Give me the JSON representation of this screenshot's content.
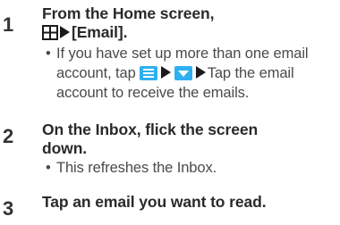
{
  "steps": [
    {
      "number": "1",
      "text_line1": "From the Home screen,",
      "text_line2": "[Email].",
      "apps_icon": "apps-grid-icon",
      "bullet": {
        "line1": "If you have set up more than one email",
        "line2_prefix": "account, tap",
        "line3": "account to receive the emails.",
        "tap_the_email": "Tap the email",
        "menu_icon": "menu-icon",
        "dropdown_icon": "dropdown-icon"
      }
    },
    {
      "number": "2",
      "text_line1": "On the Inbox, flick the screen",
      "text_line2": "down.",
      "bullet": {
        "line1": "This refreshes the Inbox."
      }
    },
    {
      "number": "3",
      "text_line1": "Tap an email you want to read."
    }
  ],
  "bullet_char": "•",
  "colors": {
    "icon_blue": "#2fb0f0",
    "heading_text": "#2a2a2a",
    "body_text": "#4a4a4a"
  }
}
